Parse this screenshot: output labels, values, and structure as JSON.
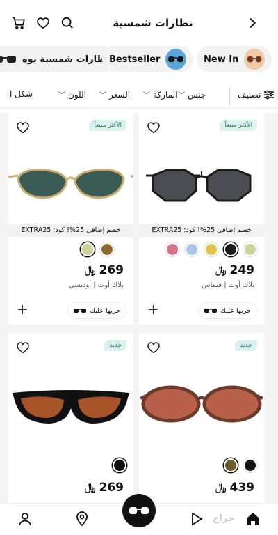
{
  "header": {
    "title": "نظارات شمسية"
  },
  "chips": [
    {
      "label": "نظارات شمسية بوه"
    },
    {
      "label": "Bestseller"
    },
    {
      "label": "New In"
    }
  ],
  "filters": {
    "sort": "تصنيف",
    "items": [
      {
        "label": "جنس"
      },
      {
        "label": "الماركة"
      },
      {
        "label": "السعر"
      },
      {
        "label": "اللون"
      },
      {
        "label": "شكل ا"
      }
    ]
  },
  "products": [
    {
      "badge": "الأكثر مبيعاً",
      "promo": "خصم إضافي 25%! كود: EXTRA25",
      "price": "249",
      "brand": "بلاك أوت | فيماس",
      "try_on": "جربها عليك",
      "lens_color": "#4a4e52",
      "frame_color": "#1c1c1c",
      "swatches": [
        "#c9d39a",
        "#1a1a1a",
        "#e3c34a",
        "#a9c6e8",
        "#d6758a"
      ]
    },
    {
      "badge": "الأكثر مبيعاً",
      "promo": "خصم إضافي 25%! كود: EXTRA25",
      "price": "269",
      "brand": "بلاك أوت | أوديسي",
      "try_on": "جربها عليك",
      "lens_color": "#3b5b55",
      "frame_color": "#c9ab6b",
      "swatches": [
        "#8a6a2f",
        "#cfcf9a"
      ]
    },
    {
      "badge": "جديد",
      "price": "439",
      "lens_color": "#b9604a",
      "frame_color": "#6b3a2a",
      "swatches": [
        "#111111",
        "#6b5a2a"
      ]
    },
    {
      "badge": "جديد",
      "price": "269",
      "lens_color": "#a7542a",
      "frame_color": "#111111",
      "swatches": [
        "#111111"
      ]
    }
  ],
  "currency_icon": "riyal-icon",
  "watermark": "حراج",
  "colors": {
    "badge_bg": "#d9f2ef",
    "badge_text": "#2a7a72",
    "grid_bg": "#f4f4f4"
  }
}
